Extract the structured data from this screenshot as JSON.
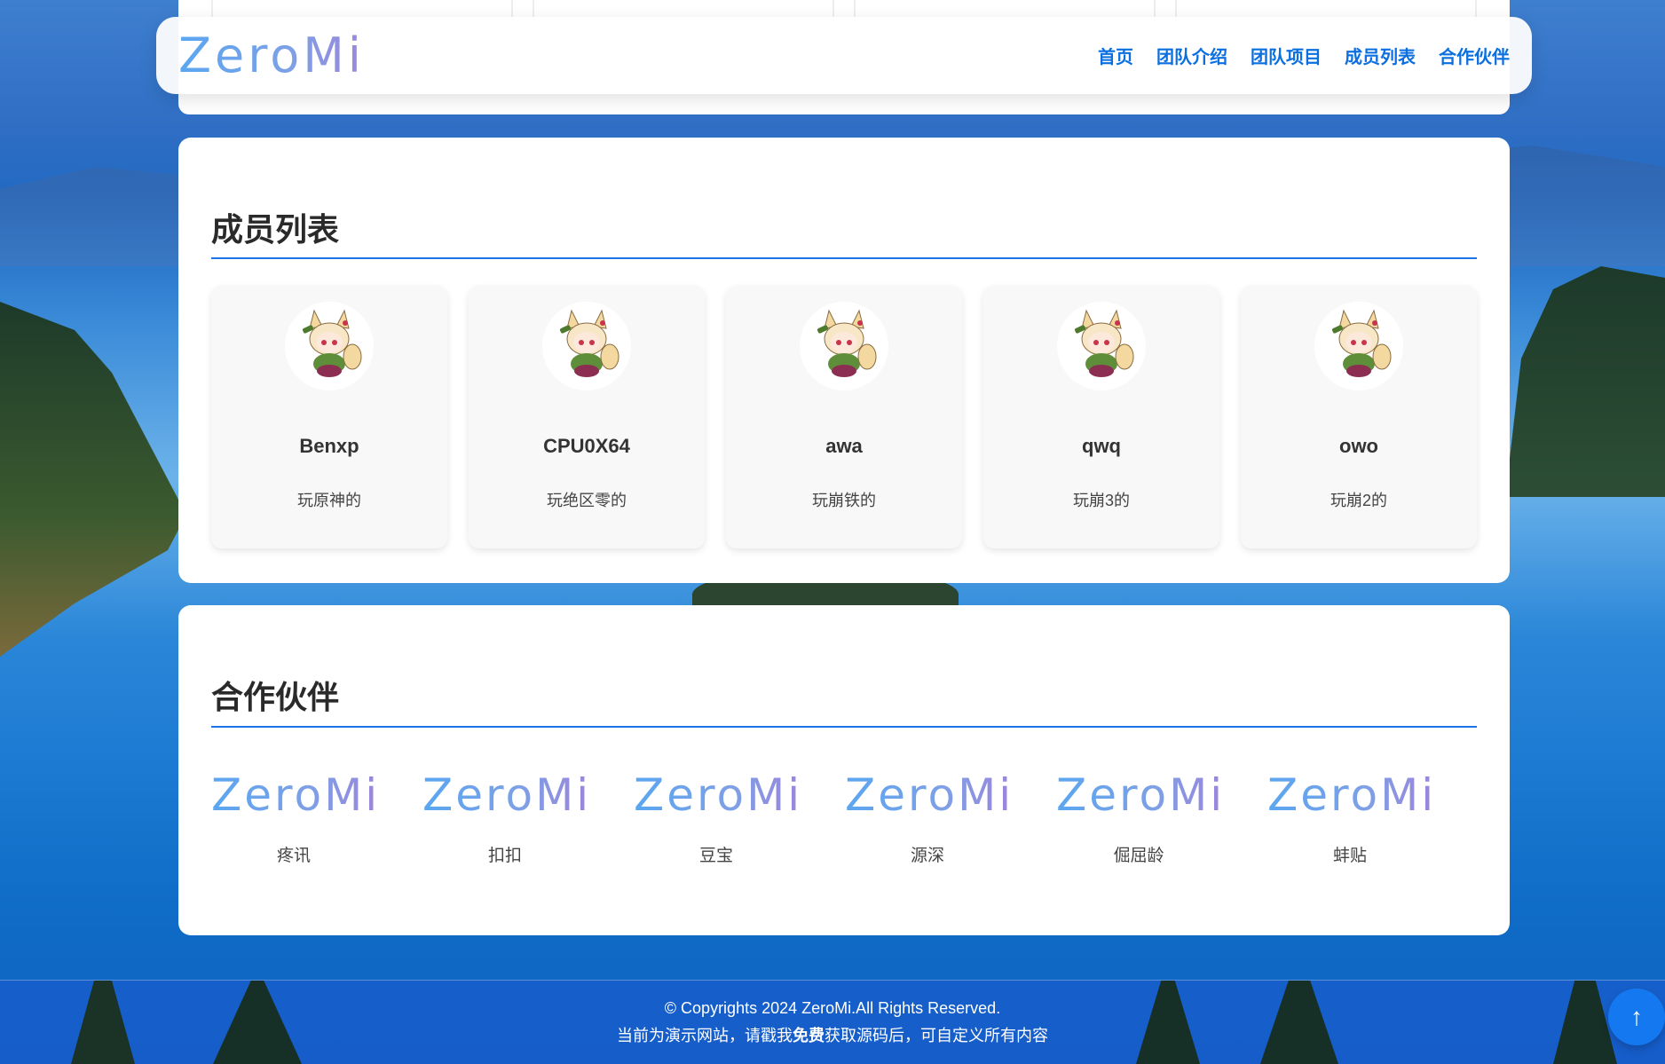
{
  "header": {
    "logo": "ZeroMi",
    "nav": [
      "首页",
      "团队介绍",
      "团队项目",
      "成员列表",
      "合作伙伴"
    ]
  },
  "members_section": {
    "title": "成员列表",
    "members": [
      {
        "name": "Benxp",
        "desc": "玩原神的"
      },
      {
        "name": "CPU0X64",
        "desc": "玩绝区零的"
      },
      {
        "name": "awa",
        "desc": "玩崩铁的"
      },
      {
        "name": "qwq",
        "desc": "玩崩3的"
      },
      {
        "name": "owo",
        "desc": "玩崩2的"
      }
    ]
  },
  "partners_section": {
    "title": "合作伙伴",
    "partners": [
      {
        "logo": "ZeroMi",
        "name": "疼讯"
      },
      {
        "logo": "ZeroMi",
        "name": "扣扣"
      },
      {
        "logo": "ZeroMi",
        "name": "豆宝"
      },
      {
        "logo": "ZeroMi",
        "name": "源深"
      },
      {
        "logo": "ZeroMi",
        "name": "倔屈龄"
      },
      {
        "logo": "ZeroMi",
        "name": "蚌贴"
      }
    ]
  },
  "footer": {
    "copyright": "© Copyrights 2024 ZeroMi.All Rights Reserved.",
    "note_prefix": "当前为演示网站，请戳我",
    "note_bold": "免费",
    "note_suffix": "获取源码后，可自定义所有内容"
  },
  "back_to_top": {
    "icon": "arrow-up-icon",
    "glyph": "↑"
  },
  "colors": {
    "accent": "#1a73e8",
    "nav": "#0b6fe0",
    "footer_bg": "#1e5ad2"
  }
}
